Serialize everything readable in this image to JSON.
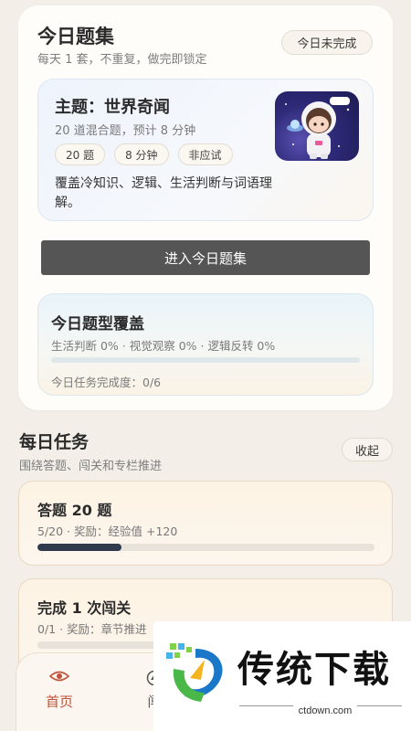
{
  "today": {
    "title": "今日题集",
    "subtitle": "每天 1 套，不重复，做完即锁定",
    "status": "今日未完成",
    "theme": {
      "title": "主题：世界奇闻",
      "subtitle": "20 道混合题，预计 8 分钟",
      "tags": [
        "20 题",
        "8 分钟",
        "非应试"
      ],
      "description": "覆盖冷知识、逻辑、生活判断与词语理解。",
      "image_icon": "astronaut-icon"
    },
    "enter_button": "进入今日题集",
    "coverage": {
      "title": "今日题型覆盖",
      "breakdown": "生活判断 0% · 视觉观察 0% · 逻辑反转 0%",
      "progress": 0,
      "completion": "今日任务完成度：0/6"
    }
  },
  "daily": {
    "title": "每日任务",
    "subtitle": "围绕答题、闯关和专栏推进",
    "collapse": "收起",
    "tasks": [
      {
        "title": "答题 20 题",
        "detail": "5/20 · 奖励：经验值 +120",
        "progress": 0.25
      },
      {
        "title": "完成 1 次闯关",
        "detail": "0/1 · 奖励：章节推进",
        "progress": 0
      }
    ]
  },
  "nav": {
    "items": [
      {
        "label": "首页",
        "icon": "eye-icon",
        "active": true
      },
      {
        "label": "闯",
        "icon": "compass-icon",
        "active": false
      }
    ]
  },
  "watermark": {
    "brand": "传统下载",
    "url": "ctdown.com"
  },
  "colors": {
    "accent_active": "#c0533a",
    "progress_fill": "#2f3a4d",
    "button_bg": "#555555"
  }
}
